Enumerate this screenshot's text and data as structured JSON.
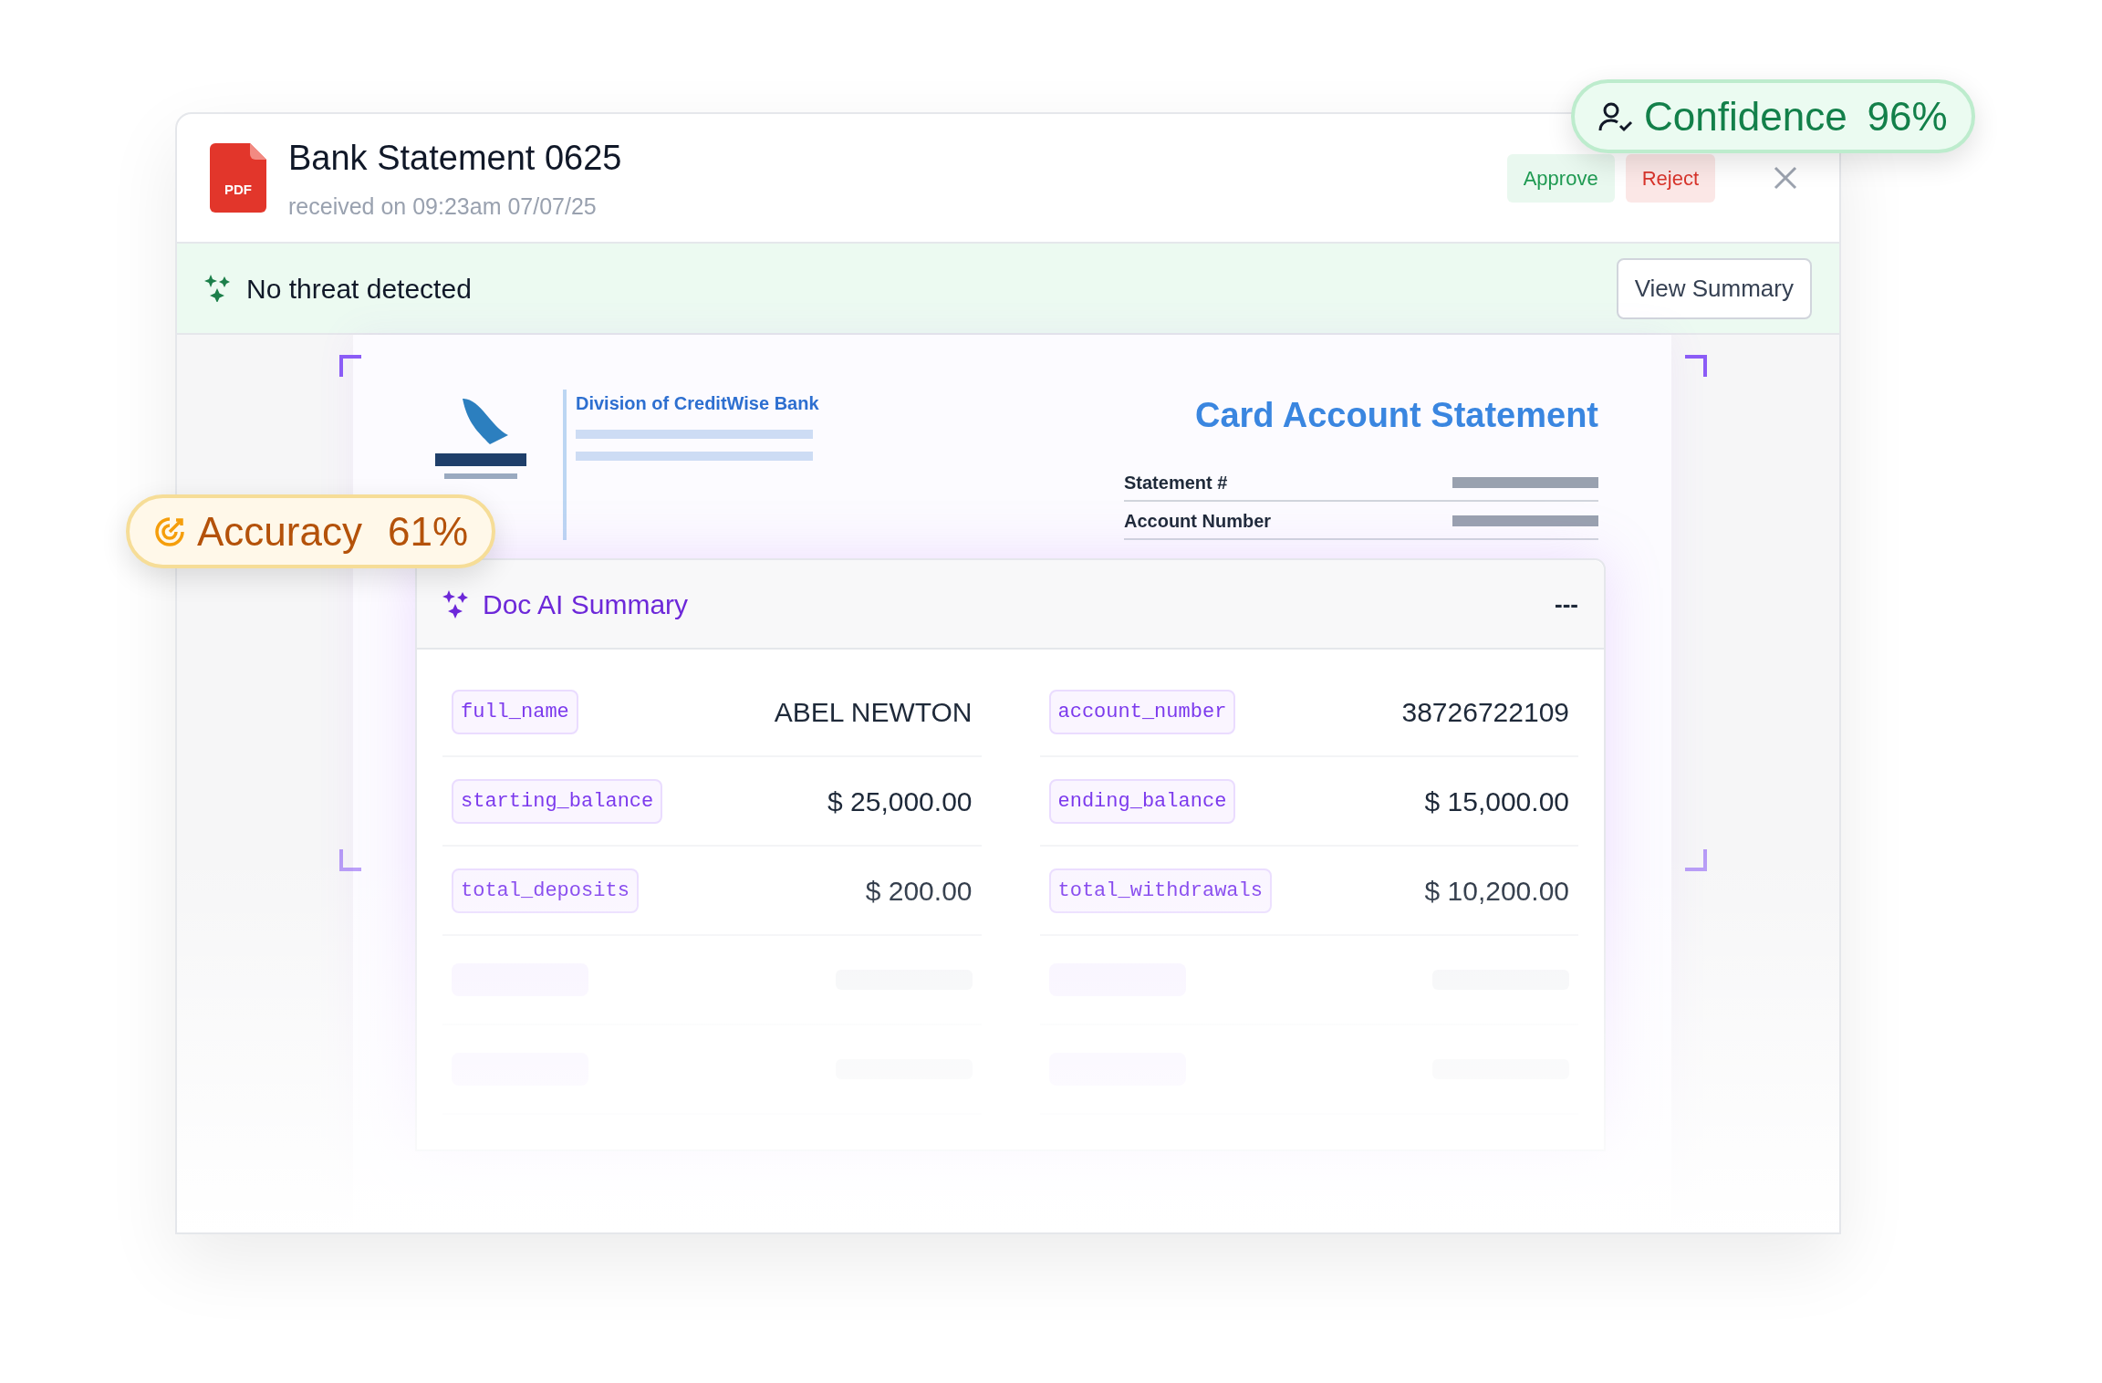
{
  "document": {
    "title": "Bank Statement 0625",
    "received": "received on 09:23am 07/07/25",
    "file_type": "PDF"
  },
  "actions": {
    "approve": "Approve",
    "reject": "Reject"
  },
  "confidence": {
    "label": "Confidence",
    "value": "96%"
  },
  "threat_banner": {
    "text": "No threat detected",
    "button": "View Summary"
  },
  "accuracy": {
    "label": "Accuracy",
    "value": "61%"
  },
  "statement_preview": {
    "bank_line": "Division of CreditWise Bank",
    "heading": "Card Account Statement",
    "fields": [
      "Statement #",
      "Account Number"
    ]
  },
  "summary": {
    "title": "Doc AI Summary",
    "menu": "---",
    "rows": [
      {
        "kind": "field",
        "cells": [
          {
            "key": "full_name",
            "value": "ABEL NEWTON"
          },
          {
            "key": "account_number",
            "value": "38726722109"
          }
        ]
      },
      {
        "kind": "field",
        "cells": [
          {
            "key": "starting_balance",
            "value": "$ 25,000.00"
          },
          {
            "key": "ending_balance",
            "value": "$ 15,000.00"
          }
        ]
      },
      {
        "kind": "field",
        "cells": [
          {
            "key": "total_deposits",
            "value": "$ 200.00"
          },
          {
            "key": "total_withdrawals",
            "value": "$ 10,200.00"
          }
        ]
      },
      {
        "kind": "redacted"
      },
      {
        "kind": "redacted"
      }
    ]
  }
}
